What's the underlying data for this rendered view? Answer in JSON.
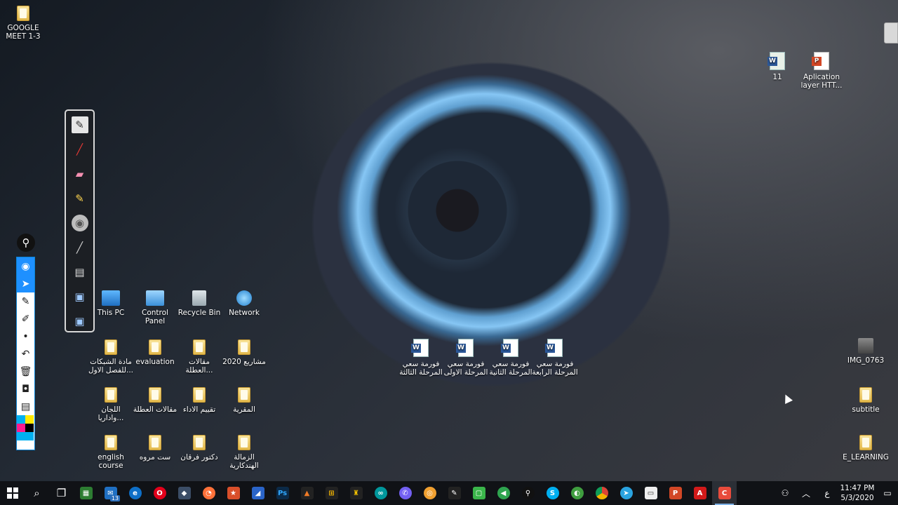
{
  "desktop": {
    "top_left_icon": {
      "label": "GOOGLE MEET 1-3"
    },
    "top_right_icons": [
      {
        "label": "11"
      },
      {
        "label": "Aplication layer HTT..."
      }
    ],
    "system_icons": [
      {
        "label": "This PC"
      },
      {
        "label": "Control Panel"
      },
      {
        "label": "Recycle Bin"
      },
      {
        "label": "Network"
      }
    ],
    "folders_row1": [
      {
        "label": "مادة الشبكات للفصل الاول..."
      },
      {
        "label": "evaluation"
      },
      {
        "label": "مقالات العطلة..."
      },
      {
        "label": "مشاريع 2020"
      }
    ],
    "folders_row2": [
      {
        "label": "اللجان واداريا..."
      },
      {
        "label": "مقالات العطلة"
      },
      {
        "label": "تقييم الاداء"
      },
      {
        "label": "المقرية"
      }
    ],
    "folders_row3": [
      {
        "label": "english course"
      },
      {
        "label": "ست مروه"
      },
      {
        "label": "دكتور فرقان"
      },
      {
        "label": "الزمالة الهندكارية"
      }
    ],
    "documents": [
      {
        "label": "فورمة سعي المرحلة الثالثة"
      },
      {
        "label": "فورمة سعي المرحلة الاولى"
      },
      {
        "label": "فورمة سعي المرحلة الثانية"
      },
      {
        "label": "فورمة سعي المرحلة الرابعة"
      }
    ],
    "right_icons": [
      {
        "label": "IMG_0763"
      },
      {
        "label": "subtitle"
      },
      {
        "label": "E_LEARNING"
      }
    ]
  },
  "taskbar": {
    "search_badge": "13",
    "tray": {
      "lang": "ع",
      "time": "11:47 PM",
      "date": "5/3/2020"
    }
  }
}
